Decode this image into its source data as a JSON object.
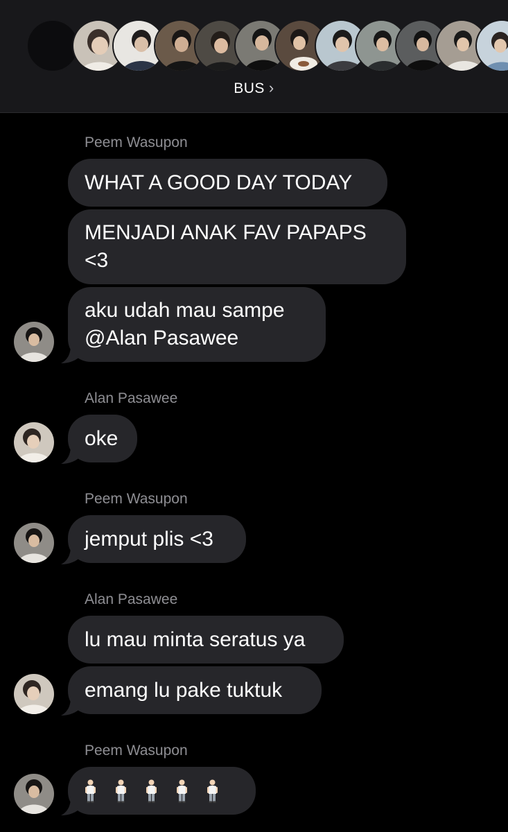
{
  "header": {
    "group_name": "BUS",
    "chevron": "›",
    "member_avatars": [
      "avatar-1",
      "avatar-2",
      "avatar-3",
      "avatar-4",
      "avatar-5",
      "avatar-6",
      "avatar-7",
      "avatar-8",
      "avatar-9",
      "avatar-10",
      "avatar-11",
      "avatar-12",
      "avatar-13",
      "avatar-14",
      "avatar-15"
    ]
  },
  "messages": {
    "group1": {
      "sender": "Peem Wasupon",
      "bubbles": [
        "WHAT A GOOD DAY TODAY",
        "MENJADI ANAK FAV PAPAPS\n<3",
        "aku udah mau sampe\n@Alan Pasawee"
      ]
    },
    "group2": {
      "sender": "Alan Pasawee",
      "bubbles": [
        "oke"
      ]
    },
    "group3": {
      "sender": "Peem Wasupon",
      "bubbles": [
        "jemput plis <3"
      ]
    },
    "group4": {
      "sender": "Alan Pasawee",
      "bubbles": [
        "lu mau minta seratus ya",
        "emang lu pake tuktuk"
      ]
    },
    "group5": {
      "sender": "Peem Wasupon",
      "emoji_icon": "standing-person-emoji",
      "emoji_count": 5
    }
  },
  "colors": {
    "background": "#000000",
    "header_bg": "#18181b",
    "bubble": "#26262a",
    "sender_text": "#8e8e93",
    "text": "#ffffff"
  }
}
